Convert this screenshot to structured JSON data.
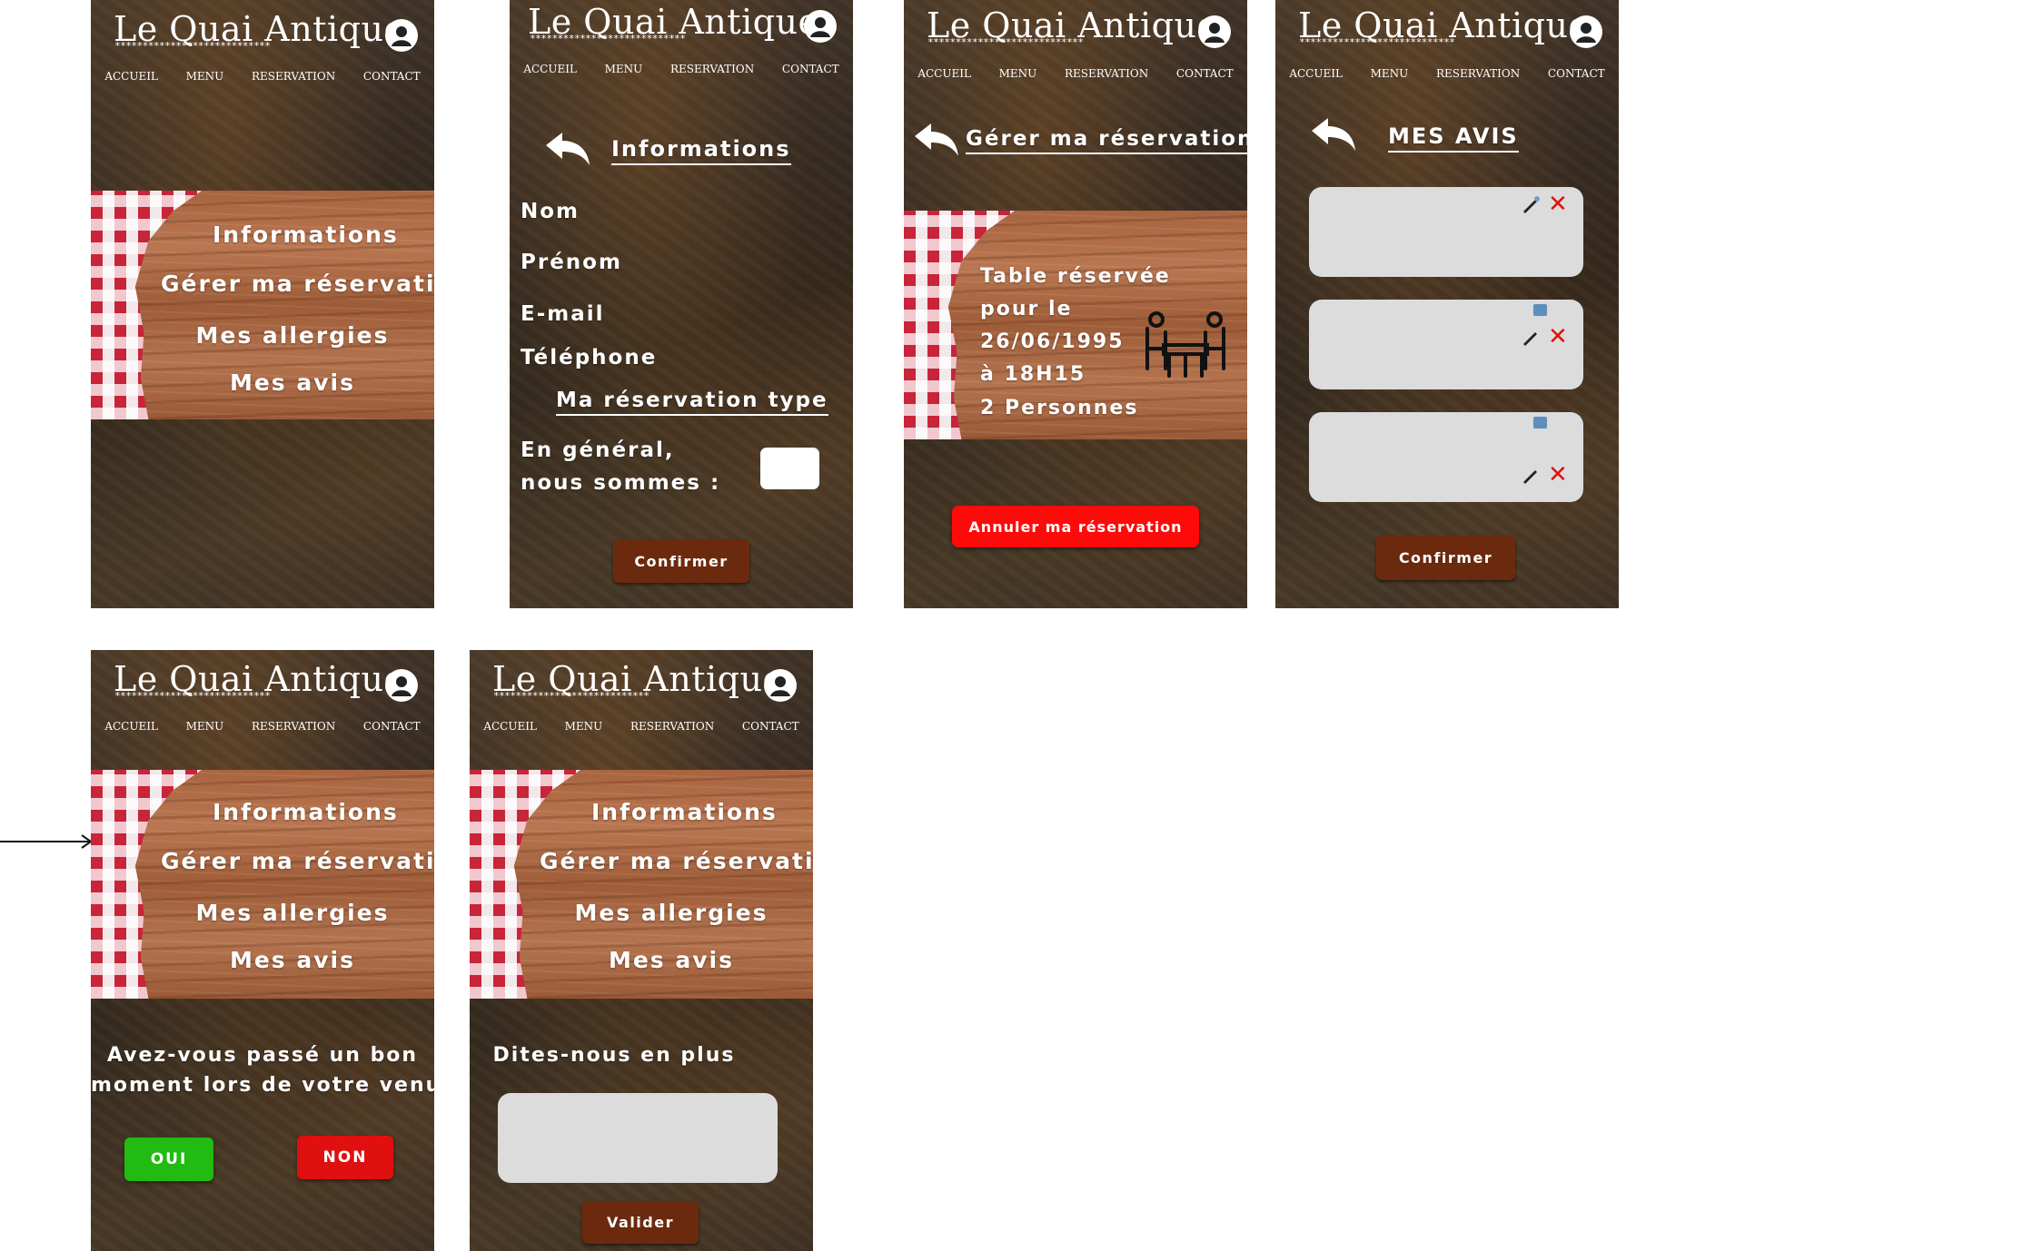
{
  "header": {
    "logo": "Le Quai Antique",
    "stars": "****************************",
    "nav": [
      "ACCUEIL",
      "MENU",
      "RESERVATION",
      "CONTACT"
    ]
  },
  "account_menu": {
    "items": [
      "Informations",
      "Gérer ma réservation",
      "Mes allergies",
      "Mes avis"
    ]
  },
  "informations": {
    "title": "Informations",
    "fields": [
      "Nom",
      "Prénom",
      "E-mail",
      "Téléphone"
    ],
    "section_title": "Ma réservation type",
    "guests_label_line1": "En général,",
    "guests_label_line2": "nous sommes :",
    "confirm": "Confirmer"
  },
  "reservation": {
    "title": "Gérer ma réservation",
    "lines": [
      "Table réservée",
      "pour le",
      "26/06/1995",
      "à 18H15",
      "2 Personnes"
    ],
    "cancel": "Annuler ma réservation"
  },
  "reviews": {
    "title": "MES AVIS",
    "confirm": "Confirmer",
    "delete_symbol": "✕"
  },
  "feedback": {
    "question_line1": "Avez-vous passé un bon",
    "question_line2": "moment lors de votre venue ?",
    "yes": "OUI",
    "no": "NON"
  },
  "details": {
    "prompt": "Dites-nous en plus",
    "submit": "Valider"
  },
  "colors": {
    "brown_button": "#6b2a0e",
    "cancel_red": "#ff0000",
    "yes_green": "#22bb11",
    "no_red": "#e01010",
    "input_grey": "#dcdcdc"
  }
}
